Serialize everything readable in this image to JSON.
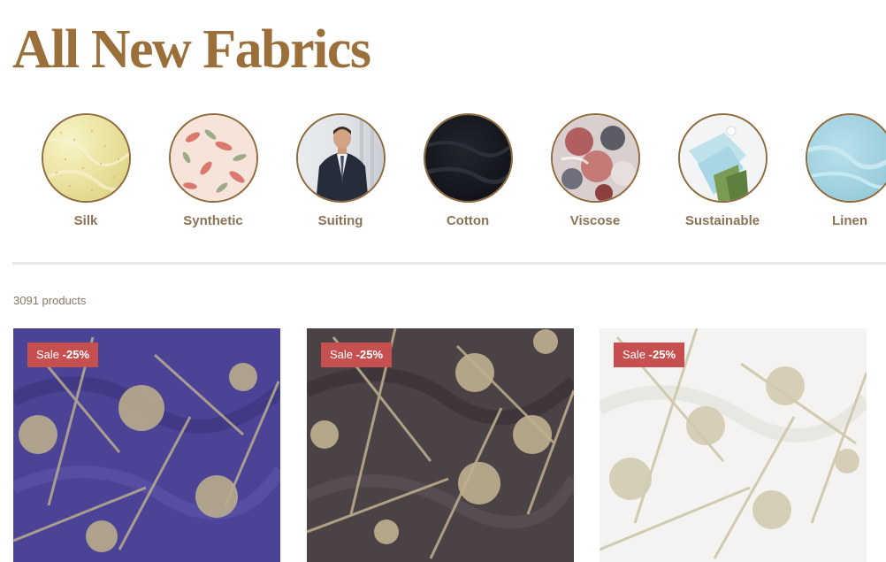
{
  "header": {
    "title": "All New Fabrics"
  },
  "categories": [
    {
      "label": "Silk",
      "icon": "silk-swatch-image",
      "color": "#ece6a4"
    },
    {
      "label": "Synthetic",
      "icon": "synthetic-floral-swatch-image",
      "color": "#f3ddd2"
    },
    {
      "label": "Suiting",
      "icon": "suiting-model-image",
      "color": "#2a3040"
    },
    {
      "label": "Cotton",
      "icon": "cotton-swatch-image",
      "color": "#161820"
    },
    {
      "label": "Viscose",
      "icon": "viscose-print-swatch-image",
      "color": "#b88a82"
    },
    {
      "label": "Sustainable",
      "icon": "sustainable-fabric-image",
      "color": "#bfe0ea"
    },
    {
      "label": "Linen",
      "icon": "linen-swatch-image",
      "color": "#9fd0de"
    }
  ],
  "results": {
    "count_label": "3091 products"
  },
  "products": [
    {
      "sale_prefix": "Sale",
      "sale_discount": "-25%",
      "fabric_color": "#4b4395",
      "pattern_color": "#b9ad8d"
    },
    {
      "sale_prefix": "Sale",
      "sale_discount": "-25%",
      "fabric_color": "#4b4246",
      "pattern_color": "#bfb190"
    },
    {
      "sale_prefix": "Sale",
      "sale_discount": "-25%",
      "fabric_color": "#f4f3f1",
      "pattern_color": "#cfc6a8"
    }
  ]
}
